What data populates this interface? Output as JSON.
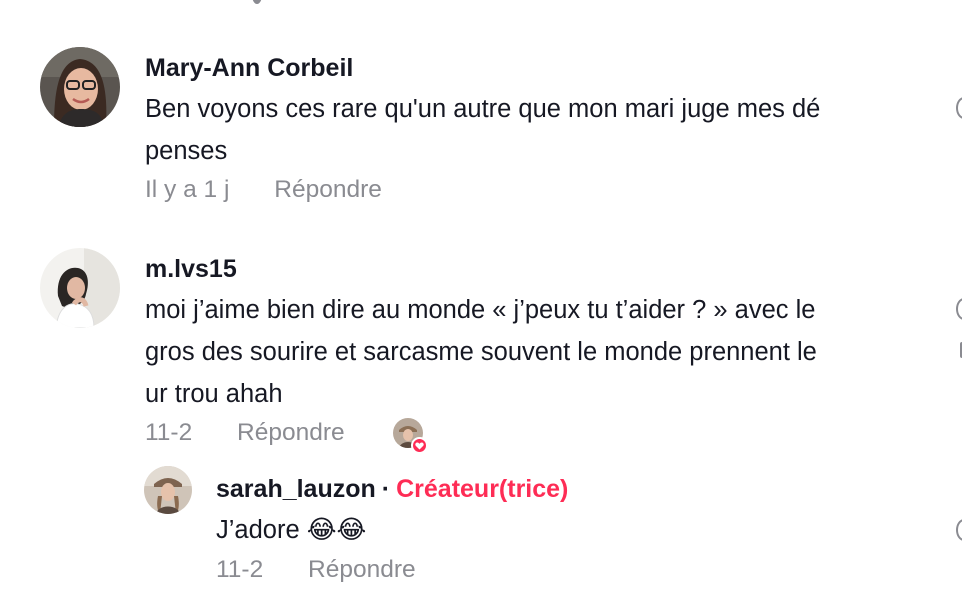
{
  "comments": [
    {
      "username": "Mary-Ann Corbeil",
      "text": "Ben voyons ces rare qu'un autre que mon mari juge mes dé",
      "text_line2": "penses",
      "time": "Il y a 1 j",
      "reply_label": "Répondre"
    },
    {
      "username": "m.lvs15",
      "text_line1": "moi j’aime bien dire au monde « j’peux tu t’aider ? » avec le",
      "text_line2": "gros des sourire et sarcasme souvent le monde prennent le",
      "text_line3": "ur trou ahah",
      "time": "11-2",
      "reply_label": "Répondre",
      "liked_by_creator": true
    }
  ],
  "reply": {
    "username": "sarah_lauzon",
    "separator": "·",
    "creator_label": "Créateur(trice)",
    "text": "J’adore 😂😂",
    "time": "11-2",
    "reply_label": "Répondre"
  },
  "colors": {
    "creator_accent": "#fe2c55",
    "meta_gray": "#8a8b91",
    "text_dark": "#161823"
  },
  "icons": {
    "like": "heart-outline-icon",
    "creator_liked": "heart-badge-icon"
  }
}
